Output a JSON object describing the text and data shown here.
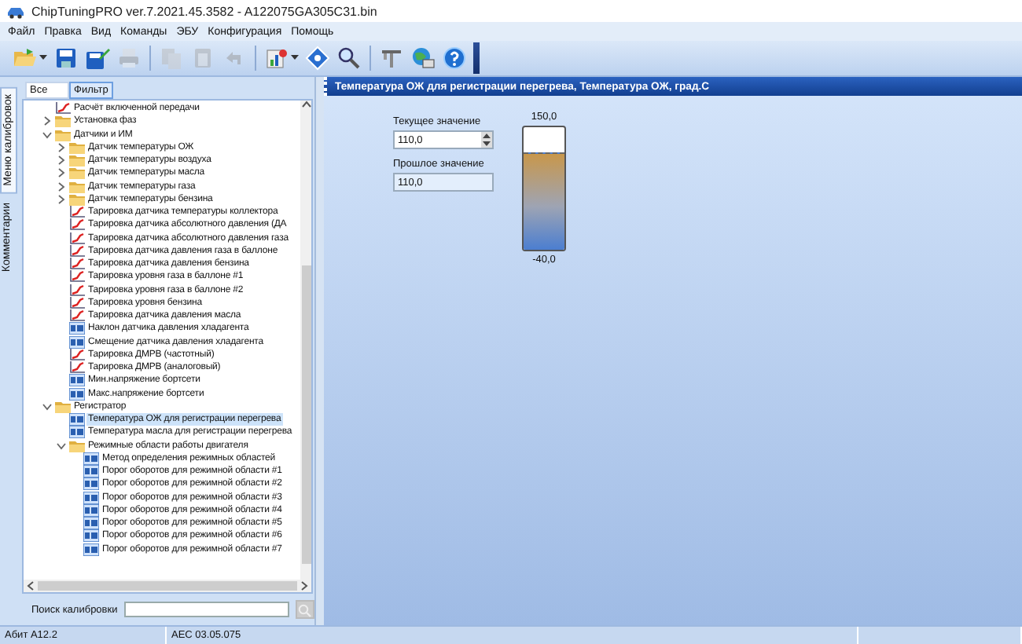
{
  "window": {
    "title": "ChipTuningPRO ver.7.2021.45.3582 - A122075GA305C31.bin"
  },
  "menu": [
    "Файл",
    "Правка",
    "Вид",
    "Команды",
    "ЭБУ",
    "Конфигурация",
    "Помощь"
  ],
  "toolbar": [
    {
      "kind": "open",
      "disabled": false,
      "dropdown": true
    },
    {
      "kind": "save",
      "disabled": false,
      "dropdown": false
    },
    {
      "kind": "save_as",
      "disabled": false,
      "dropdown": false
    },
    {
      "kind": "print",
      "disabled": true,
      "dropdown": false
    },
    {
      "kind": "separator"
    },
    {
      "kind": "copy",
      "disabled": true,
      "dropdown": false
    },
    {
      "kind": "paste",
      "disabled": true,
      "dropdown": false
    },
    {
      "kind": "undo",
      "disabled": true,
      "dropdown": false
    },
    {
      "kind": "separator"
    },
    {
      "kind": "chart",
      "disabled": false,
      "dropdown": true
    },
    {
      "kind": "diamond",
      "disabled": false,
      "dropdown": false
    },
    {
      "kind": "search",
      "disabled": false,
      "dropdown": false
    },
    {
      "kind": "separator"
    },
    {
      "kind": "tools",
      "disabled": false,
      "dropdown": false
    },
    {
      "kind": "monitor",
      "disabled": false,
      "dropdown": false
    },
    {
      "kind": "help",
      "disabled": false,
      "dropdown": false
    }
  ],
  "side_tabs": [
    {
      "label": "Меню калибровок",
      "selected": true
    },
    {
      "label": "Комментарии",
      "selected": false
    }
  ],
  "filter_tabs": [
    {
      "label": "Все",
      "selected": false
    },
    {
      "label": "Фильтр",
      "selected": true
    }
  ],
  "tree": [
    {
      "label": "Расчёт включенной передачи",
      "kind": "curve",
      "selected": false
    },
    {
      "label": "Установка фаз",
      "kind": "folder",
      "expanded": false,
      "selected": false
    },
    {
      "label": "Датчики и ИМ",
      "kind": "folder",
      "expanded": true,
      "selected": false,
      "children": [
        {
          "label": "Датчик температуры ОЖ",
          "kind": "folder",
          "expanded": false,
          "selected": false
        },
        {
          "label": "Датчик температуры воздуха",
          "kind": "folder",
          "expanded": false,
          "selected": false
        },
        {
          "label": "Датчик температуры масла",
          "kind": "folder",
          "expanded": false,
          "selected": false
        },
        {
          "label": "Датчик температуры газа",
          "kind": "folder",
          "expanded": false,
          "selected": false
        },
        {
          "label": "Датчик температуры бензина",
          "kind": "folder",
          "expanded": false,
          "selected": false
        },
        {
          "label": "Тарировка датчика температуры коллектора",
          "kind": "curve",
          "selected": false
        },
        {
          "label": "Тарировка датчика абсолютного давления (ДА",
          "kind": "curve",
          "selected": false
        },
        {
          "label": "Тарировка датчика абсолютного давления газа",
          "kind": "curve",
          "selected": false
        },
        {
          "label": "Тарировка датчика давления газа в баллоне",
          "kind": "curve",
          "selected": false
        },
        {
          "label": "Тарировка датчика давления бензина",
          "kind": "curve",
          "selected": false
        },
        {
          "label": "Тарировка уровня газа в баллоне #1",
          "kind": "curve",
          "selected": false
        },
        {
          "label": "Тарировка уровня газа в баллоне #2",
          "kind": "curve",
          "selected": false
        },
        {
          "label": "Тарировка уровня бензина",
          "kind": "curve",
          "selected": false
        },
        {
          "label": "Тарировка датчика давления масла",
          "kind": "curve",
          "selected": false
        },
        {
          "label": "Наклон датчика давления хладагента",
          "kind": "value",
          "selected": false
        },
        {
          "label": "Смещение датчика давления хладагента",
          "kind": "value",
          "selected": false
        },
        {
          "label": "Тарировка ДМРВ (частотный)",
          "kind": "curve",
          "selected": false
        },
        {
          "label": "Тарировка ДМРВ (аналоговый)",
          "kind": "curve",
          "selected": false
        },
        {
          "label": "Мин.напряжение бортсети",
          "kind": "value",
          "selected": false
        },
        {
          "label": "Макс.напряжение бортсети",
          "kind": "value",
          "selected": false
        }
      ]
    },
    {
      "label": "Регистратор",
      "kind": "folder",
      "expanded": true,
      "selected": false,
      "children": [
        {
          "label": "Температура ОЖ для регистрации перегрева",
          "kind": "value",
          "selected": true
        },
        {
          "label": "Температура масла для регистрации перегрева",
          "kind": "value",
          "selected": false
        },
        {
          "label": "Режимные области работы двигателя",
          "kind": "folder",
          "expanded": true,
          "selected": false,
          "children": [
            {
              "label": "Метод определения режимных областей",
              "kind": "value",
              "selected": false
            },
            {
              "label": "Порог оборотов для режимной области #1",
              "kind": "value",
              "selected": false
            },
            {
              "label": "Порог оборотов для режимной области #2",
              "kind": "value",
              "selected": false
            },
            {
              "label": "Порог оборотов для режимной области #3",
              "kind": "value",
              "selected": false
            },
            {
              "label": "Порог оборотов для режимной области #4",
              "kind": "value",
              "selected": false
            },
            {
              "label": "Порог оборотов для режимной области #5",
              "kind": "value",
              "selected": false
            },
            {
              "label": "Порог оборотов для режимной области #6",
              "kind": "value",
              "selected": false
            },
            {
              "label": "Порог оборотов для режимной области #7",
              "kind": "value",
              "selected": false
            }
          ]
        }
      ]
    }
  ],
  "search": {
    "label": "Поиск калибровки"
  },
  "editor": {
    "title": "Температура ОЖ для регистрации перегрева, Температура ОЖ, град.С",
    "current_label": "Текущее значение",
    "current_value": "110,0",
    "previous_label": "Прошлое значение",
    "previous_value": "110,0",
    "gauge": {
      "max": "150,0",
      "min": "-40,0",
      "level": 0.79
    }
  },
  "status_bar": [
    "Абит A12.2",
    "AEC 03.05.075"
  ]
}
